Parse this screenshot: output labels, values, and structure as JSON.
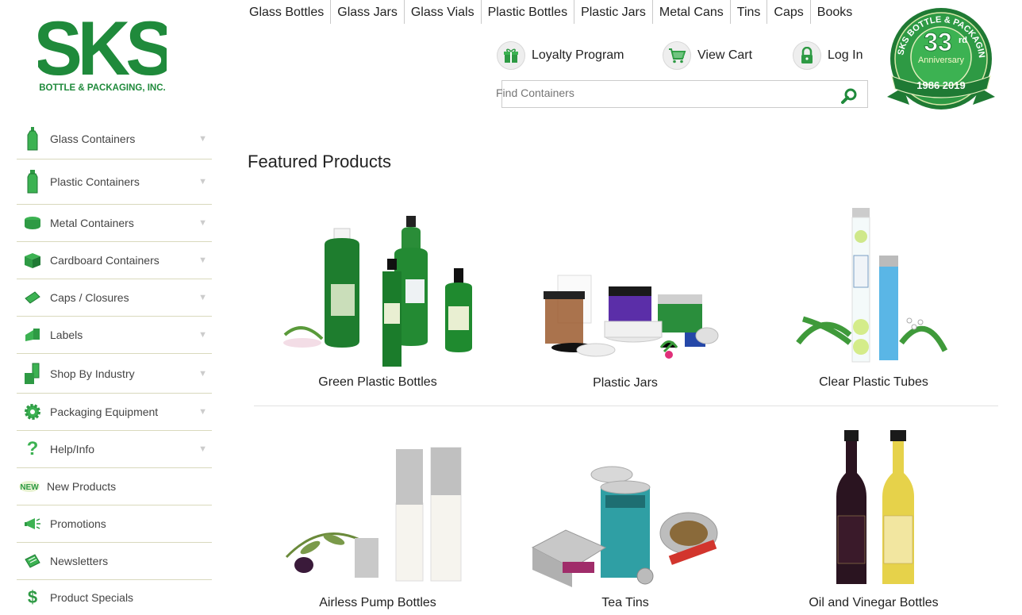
{
  "brand": {
    "logo_text": "SKS",
    "logo_sub": "BOTTLE & PACKAGING, INC.",
    "color": "#1f8a3b"
  },
  "topnav": [
    "Glass Bottles",
    "Glass Jars",
    "Glass Vials",
    "Plastic Bottles",
    "Plastic Jars",
    "Metal Cans",
    "Tins",
    "Caps",
    "Books"
  ],
  "account": {
    "loyalty": "Loyalty Program",
    "cart": "View Cart",
    "login": "Log In"
  },
  "search": {
    "placeholder": "Find Containers"
  },
  "badge": {
    "ring_text": "SKS BOTTLE & PACKAGING, INC.",
    "number": "33",
    "suffix": "rd",
    "label": "Anniversary",
    "years": "1986 2019"
  },
  "sidebar": [
    {
      "label": "Glass Containers",
      "icon": "glass-bottle-icon",
      "arrow": true
    },
    {
      "label": "Plastic Containers",
      "icon": "plastic-bottle-icon",
      "arrow": true
    },
    {
      "label": "Metal Containers",
      "icon": "metal-can-icon",
      "arrow": true
    },
    {
      "label": "Cardboard Containers",
      "icon": "box-icon",
      "arrow": true
    },
    {
      "label": "Caps / Closures",
      "icon": "cap-icon",
      "arrow": true
    },
    {
      "label": "Labels",
      "icon": "label-icon",
      "arrow": true
    },
    {
      "label": "Shop By Industry",
      "icon": "industry-icon",
      "arrow": true
    },
    {
      "label": "Packaging Equipment",
      "icon": "gear-icon",
      "arrow": true
    },
    {
      "label": "Help/Info",
      "icon": "question-icon",
      "arrow": true
    },
    {
      "label": "New Products",
      "icon": "new-icon",
      "arrow": false
    },
    {
      "label": "Promotions",
      "icon": "megaphone-icon",
      "arrow": false
    },
    {
      "label": "Newsletters",
      "icon": "newsletter-icon",
      "arrow": false
    },
    {
      "label": "Product Specials",
      "icon": "dollar-icon",
      "arrow": false
    }
  ],
  "featured_title": "Featured Products",
  "products": [
    {
      "name": "Green Plastic Bottles"
    },
    {
      "name": "Plastic Jars"
    },
    {
      "name": "Clear Plastic Tubes"
    },
    {
      "name": "Airless Pump Bottles"
    },
    {
      "name": "Tea Tins"
    },
    {
      "name": "Oil and Vinegar Bottles"
    }
  ]
}
